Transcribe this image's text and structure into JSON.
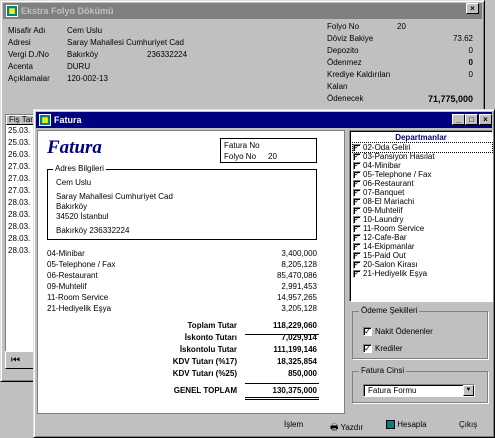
{
  "bg_window": {
    "title": "Ekstra Folyo Dökümü",
    "guest": {
      "labels": [
        "Misafir Adı",
        "Adresi",
        "Vergi D./No",
        "Acenta",
        "Açıklamalar"
      ],
      "values": [
        "Cem Uslu",
        "Saray Mahallesi Cumhuriyet Cad",
        "Bakırköy",
        "DURU",
        "120-002-13"
      ],
      "tax_no": "236332224"
    },
    "folio": {
      "labels": [
        "Folyo No",
        "Döviz Bakiye",
        "Depozito",
        "Ödenmez",
        "Krediye Kaldırılan",
        "Kalan",
        "Ödenecek"
      ],
      "folio_no": "20",
      "values": [
        "73.62",
        "0",
        "0",
        "0"
      ],
      "odenecek": "71,775,000"
    },
    "list_header": "Fiş Tar",
    "dates": [
      "25.03.",
      "25.03.",
      "26.03.",
      "27.03.",
      "27.03.",
      "27.03.",
      "28.03.",
      "28.03.",
      "28.03.",
      "28.03.",
      "28.03."
    ]
  },
  "fatura": {
    "title": "Fatura",
    "heading": "Fatura",
    "fatura_no_label": "Fatura No",
    "folyo_no_label": "Folyo No",
    "folyo_no": "20",
    "address_group": "Adres Bilgileri",
    "address": [
      "Cem Uslu",
      "Saray Mahallesi Cumhuriyet Cad",
      "Bakırköy",
      "34520 İstanbul",
      "Bakırköy  236332224"
    ],
    "items": [
      {
        "name": "04-Minibar",
        "amount": "3,400,000"
      },
      {
        "name": "05-Telephone / Fax",
        "amount": "8,205,128"
      },
      {
        "name": "06-Restaurant",
        "amount": "85,470,086"
      },
      {
        "name": "09-Muhtelif",
        "amount": "2,991,453"
      },
      {
        "name": "11-Room Service",
        "amount": "14,957,265"
      },
      {
        "name": "21-Hediyelik Eşya",
        "amount": "3,205,128"
      }
    ],
    "totals": [
      {
        "label": "Toplam Tutar",
        "value": "118,229,060"
      },
      {
        "label": "İskonto Tutarı",
        "value": "7,029,914"
      },
      {
        "label": "İskontolu Tutar",
        "value": "111,199,146"
      },
      {
        "label": "KDV Tutarı (%17)",
        "value": "18,325,854"
      },
      {
        "label": "KDV Tutarı (%25)",
        "value": "850,000"
      }
    ],
    "grand_label": "GENEL TOPLAM",
    "grand_value": "130,375,000",
    "departments_title": "Departmanlar",
    "departments": [
      "02-Oda Geliri",
      "03-Pansiyon Hasılat",
      "04-Minibar",
      "05-Telephone / Fax",
      "06-Restaurant",
      "07-Banquet",
      "08-El Mariachi",
      "09-Muhtelif",
      "10-Laundry",
      "11-Room Service",
      "12-Cafe-Bar",
      "14-Ekipmanlar",
      "15-Paid Out",
      "20-Salon Kirası",
      "21-Hediyelik Eşya"
    ],
    "payment_group": "Ödeme Şekilleri",
    "payment_options": [
      "Nakit Ödenenler",
      "Krediler"
    ],
    "invoice_type_group": "Fatura Cinsi",
    "invoice_type": "Fatura Formu",
    "buttons": {
      "islem": "İşlem",
      "yazdir": "Yazdır",
      "hesapla": "Hesapla",
      "cikis": "Çıkış"
    }
  }
}
